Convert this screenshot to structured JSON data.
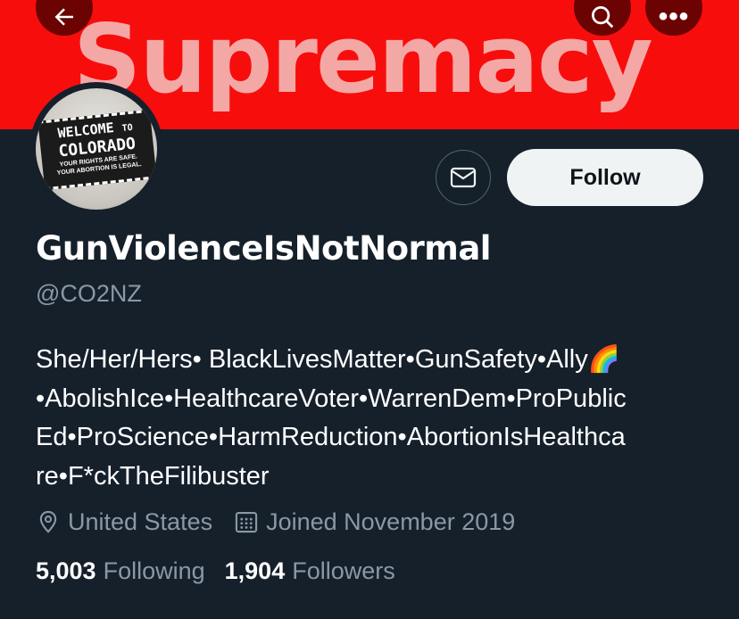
{
  "banner": {
    "text": "Supremacy",
    "color": "#f80d0d"
  },
  "top_bar": {
    "back_icon": "arrow-left-icon",
    "search_icon": "search-icon",
    "more_icon": "more-horizontal-icon",
    "more_glyph": "•••"
  },
  "avatar": {
    "sign_line1": "WELCOME",
    "sign_line1_small": "TO",
    "sign_line2": "COLORADO",
    "sign_line3": "YOUR RIGHTS ARE SAFE.",
    "sign_line4": "YOUR ABORTION IS LEGAL."
  },
  "actions": {
    "message_icon": "envelope-icon",
    "follow_label": "Follow"
  },
  "profile": {
    "display_name": "GunViolenceIsNotNormal",
    "handle": "@CO2NZ",
    "bio_lines": [
      "She/Her/Hers• BlackLivesMatter•GunSafety•Ally🌈",
      "•AbolishIce•HealthcareVoter•WarrenDem•ProPublic",
      "Ed•ProScience•HarmReduction•AbortionIsHealthca",
      "re•F*ckTheFilibuster"
    ],
    "location": "United States",
    "joined": "Joined November 2019",
    "following_count": "5,003",
    "following_label": "Following",
    "followers_count": "1,904",
    "followers_label": "Followers"
  },
  "colors": {
    "background": "#15202b",
    "secondary_text": "#8b98a5",
    "follow_button_bg": "#eff3f4"
  }
}
